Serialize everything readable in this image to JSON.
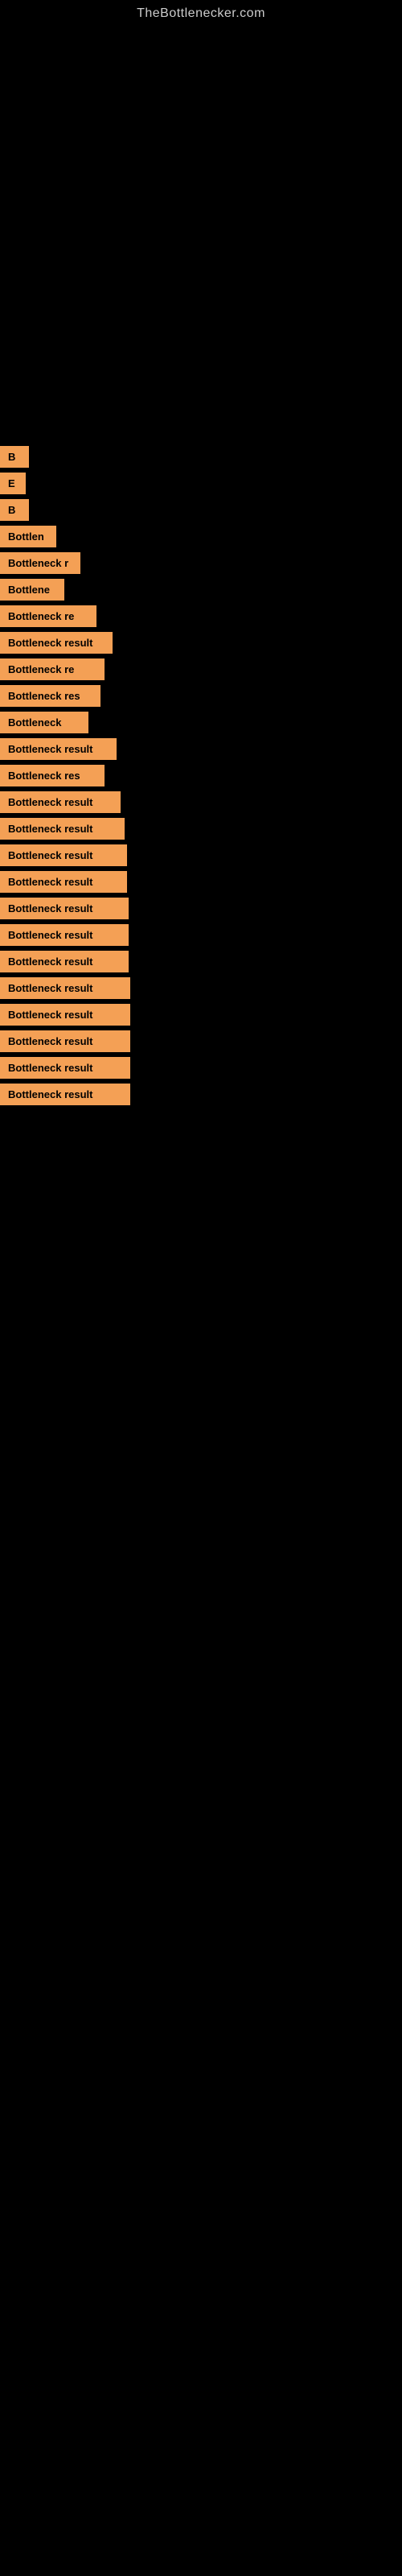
{
  "site": {
    "title": "TheBottlenecker.com"
  },
  "results": [
    {
      "id": "r1",
      "label": "B",
      "cls": "r1"
    },
    {
      "id": "r2",
      "label": "E",
      "cls": "r2"
    },
    {
      "id": "r3",
      "label": "B",
      "cls": "r3"
    },
    {
      "id": "r4",
      "label": "Bottlen",
      "cls": "r4"
    },
    {
      "id": "r5",
      "label": "Bottleneck r",
      "cls": "r5"
    },
    {
      "id": "r6",
      "label": "Bottlene",
      "cls": "r6"
    },
    {
      "id": "r7",
      "label": "Bottleneck re",
      "cls": "r7"
    },
    {
      "id": "r8",
      "label": "Bottleneck result",
      "cls": "r8"
    },
    {
      "id": "r9",
      "label": "Bottleneck re",
      "cls": "r9"
    },
    {
      "id": "r10",
      "label": "Bottleneck res",
      "cls": "r10"
    },
    {
      "id": "r11",
      "label": "Bottleneck",
      "cls": "r11"
    },
    {
      "id": "r12",
      "label": "Bottleneck result",
      "cls": "r12"
    },
    {
      "id": "r13",
      "label": "Bottleneck res",
      "cls": "r13"
    },
    {
      "id": "r14",
      "label": "Bottleneck result",
      "cls": "r14"
    },
    {
      "id": "r15",
      "label": "Bottleneck result",
      "cls": "r15"
    },
    {
      "id": "r16",
      "label": "Bottleneck result",
      "cls": "r16"
    },
    {
      "id": "r17",
      "label": "Bottleneck result",
      "cls": "r17"
    },
    {
      "id": "r18",
      "label": "Bottleneck result",
      "cls": "r18"
    },
    {
      "id": "r19",
      "label": "Bottleneck result",
      "cls": "r19"
    },
    {
      "id": "r20",
      "label": "Bottleneck result",
      "cls": "r20"
    },
    {
      "id": "r21",
      "label": "Bottleneck result",
      "cls": "r21"
    },
    {
      "id": "r22",
      "label": "Bottleneck result",
      "cls": "r22"
    },
    {
      "id": "r23",
      "label": "Bottleneck result",
      "cls": "r23"
    },
    {
      "id": "r24",
      "label": "Bottleneck result",
      "cls": "r24"
    },
    {
      "id": "r25",
      "label": "Bottleneck result",
      "cls": "r25"
    }
  ]
}
